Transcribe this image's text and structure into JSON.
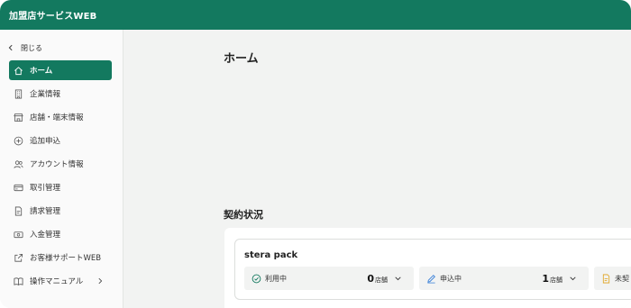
{
  "header": {
    "title": "加盟店サービスWEB"
  },
  "sidebar": {
    "close_label": "閉じる",
    "items": [
      {
        "label": "ホーム",
        "icon": "home-icon",
        "active": true
      },
      {
        "label": "企業情報",
        "icon": "building-icon"
      },
      {
        "label": "店舗・端末情報",
        "icon": "store-icon"
      },
      {
        "label": "追加申込",
        "icon": "plus-circle-icon"
      },
      {
        "label": "アカウント情報",
        "icon": "users-icon"
      },
      {
        "label": "取引管理",
        "icon": "credit-card-icon"
      },
      {
        "label": "請求管理",
        "icon": "invoice-icon"
      },
      {
        "label": "入金管理",
        "icon": "cash-icon"
      },
      {
        "label": "お客様サポートWEB",
        "icon": "external-link-icon"
      },
      {
        "label": "操作マニュアル",
        "icon": "book-icon"
      }
    ]
  },
  "main": {
    "page_title": "ホーム",
    "contract_section_title": "契約状況",
    "contract": {
      "name": "stera pack",
      "statuses": [
        {
          "label": "利用中",
          "count": "0",
          "unit": "店舗",
          "icon": "check-circle-icon",
          "color": "#13795f"
        },
        {
          "label": "申込中",
          "count": "1",
          "unit": "店舗",
          "icon": "edit-icon",
          "color": "#2f7ad6"
        },
        {
          "label": "未契",
          "icon": "document-icon",
          "color": "#e0a21b"
        }
      ]
    }
  },
  "colors": {
    "brand": "#13795f",
    "background": "#f2f3f2"
  }
}
